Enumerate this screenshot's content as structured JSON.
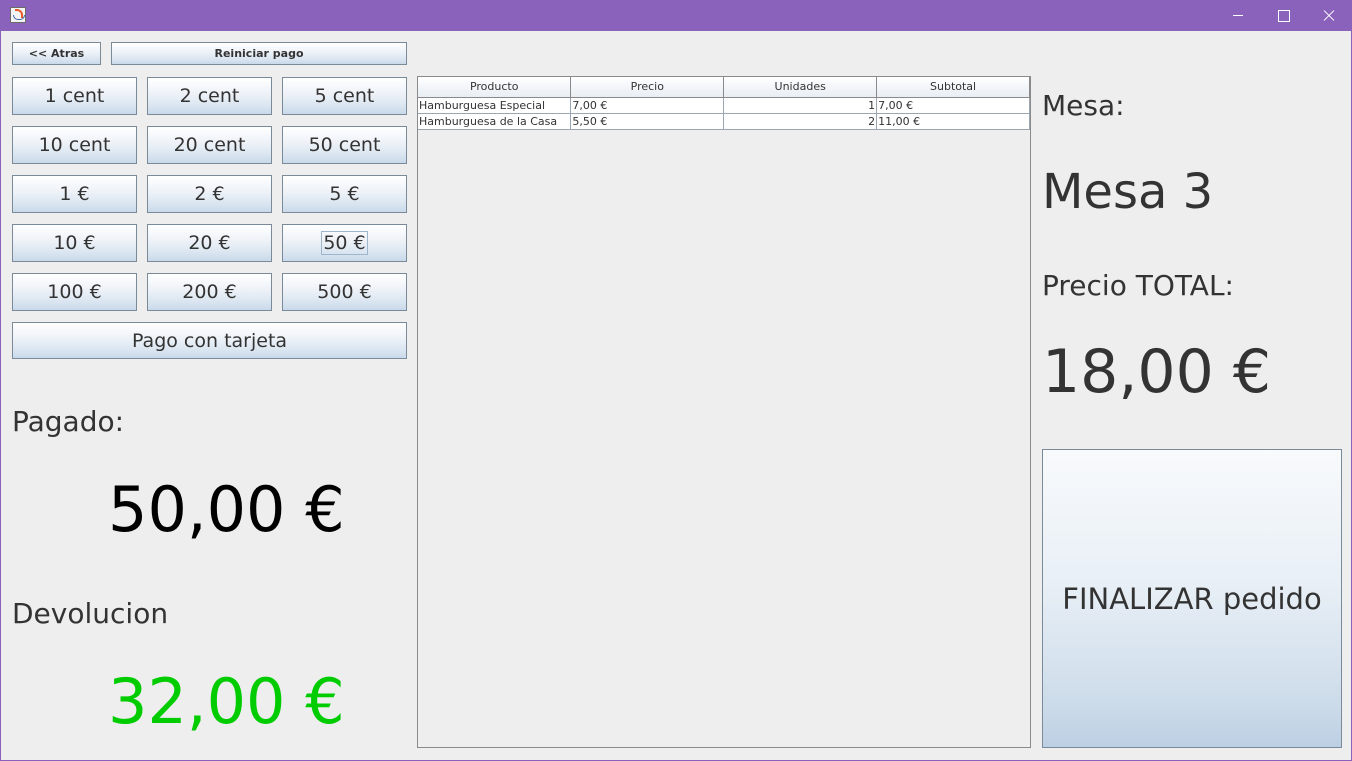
{
  "window": {
    "controls": {
      "minimize": "minimize-icon",
      "maximize": "maximize-icon",
      "close": "close-icon"
    }
  },
  "toolbar": {
    "back_label": "<< Atras",
    "reset_label": "Reiniciar pago"
  },
  "money_buttons": [
    "1 cent",
    "2 cent",
    "5 cent",
    "10 cent",
    "20 cent",
    "50 cent",
    "1 €",
    "2 €",
    "5 €",
    "10 €",
    "20 €",
    "50 €",
    "100 €",
    "200 €",
    "500 €"
  ],
  "card_button": "Pago con tarjeta",
  "paid": {
    "label": "Pagado:",
    "amount": "50,00 €"
  },
  "change": {
    "label": "Devolucion",
    "amount": "32,00 €",
    "color": "#00cc00"
  },
  "order_table": {
    "columns": [
      "Producto",
      "Precio",
      "Unidades",
      "Subtotal"
    ],
    "rows": [
      [
        "Hamburguesa Especial",
        "7,00 €",
        "1",
        "7,00 €"
      ],
      [
        "Hamburguesa de la Casa",
        "5,50 €",
        "2",
        "11,00 €"
      ]
    ]
  },
  "table_info": {
    "label": "Mesa:",
    "value": "Mesa 3"
  },
  "total": {
    "label": "Precio TOTAL:",
    "value": "18,00 €"
  },
  "finalize_button": "FINALIZAR pedido",
  "colors": {
    "titlebar": "#8b62bb",
    "background": "#eeeeee",
    "change_amount": "#00cc00"
  }
}
